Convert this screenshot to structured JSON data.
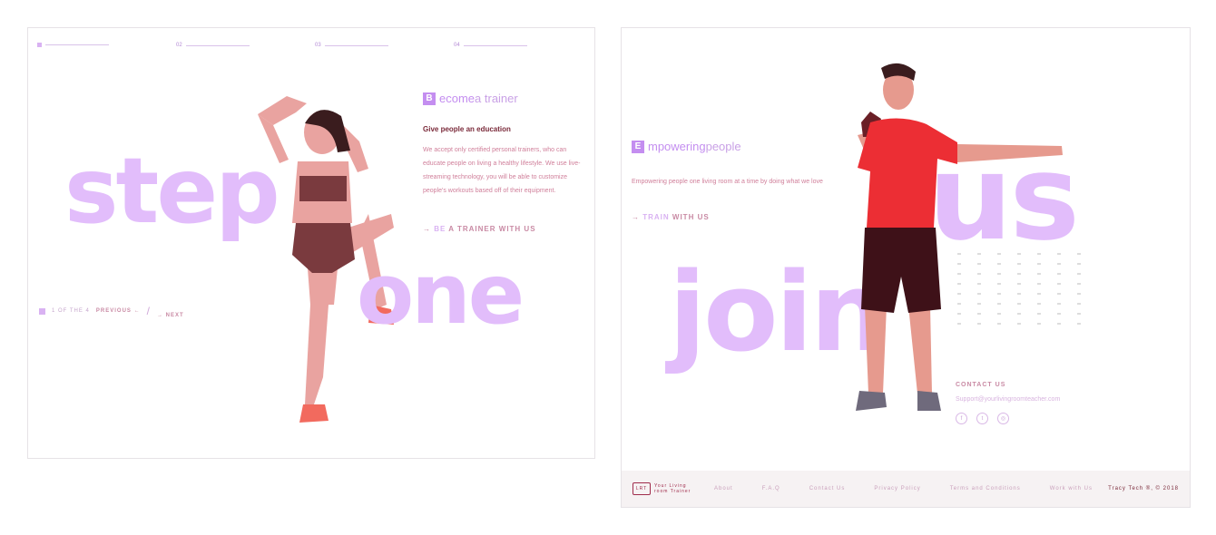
{
  "left": {
    "steps": [
      "01",
      "02",
      "03",
      "04"
    ],
    "big_words": [
      "step",
      "one"
    ],
    "heading": {
      "first_letter": "B",
      "highlight": "ecome",
      "rest": " a trainer"
    },
    "subheading": "Give people an education",
    "paragraph": "We accept only certified personal trainers, who can educate people on living a healthy lifestyle. We use live-streaming technology, you will be able to customize people's workouts based off of their equipment.",
    "cta": {
      "arrow": "→",
      "highlight": "BE",
      "rest": " A TRAINER WITH US"
    },
    "pager": {
      "count": "1 OF THE 4",
      "previous": "PREVIOUS ←",
      "slash": "/",
      "next": "→ NEXT"
    }
  },
  "right": {
    "big_words": [
      "us",
      "join"
    ],
    "heading": {
      "first_letter": "E",
      "highlight": "mpowering",
      "rest": " people"
    },
    "paragraph": "Empowering people one living room at a time by doing what we love",
    "cta": {
      "arrow": "→",
      "highlight": "TRAIN",
      "rest": " WITH US"
    },
    "contact": {
      "title": "CONTACT US",
      "email": "Support@yourlivingroomteacher.com"
    },
    "social_icons": [
      "facebook-icon",
      "twitter-icon",
      "instagram-icon"
    ],
    "footer": {
      "logo_mark": "LRT",
      "logo_text": "Your Living room Trainer",
      "links": [
        "About",
        "F.A.Q",
        "Contact Us",
        "Privacy Policy",
        "Terms and Conditions",
        "Work with Us"
      ],
      "copyright": "Tracy Tech ®, © 2018"
    }
  },
  "colors": {
    "accent": "#c48ef0",
    "big_text": "#e2bdfb",
    "dark_text": "#7a2a3a",
    "cta": "#c98aa4"
  }
}
